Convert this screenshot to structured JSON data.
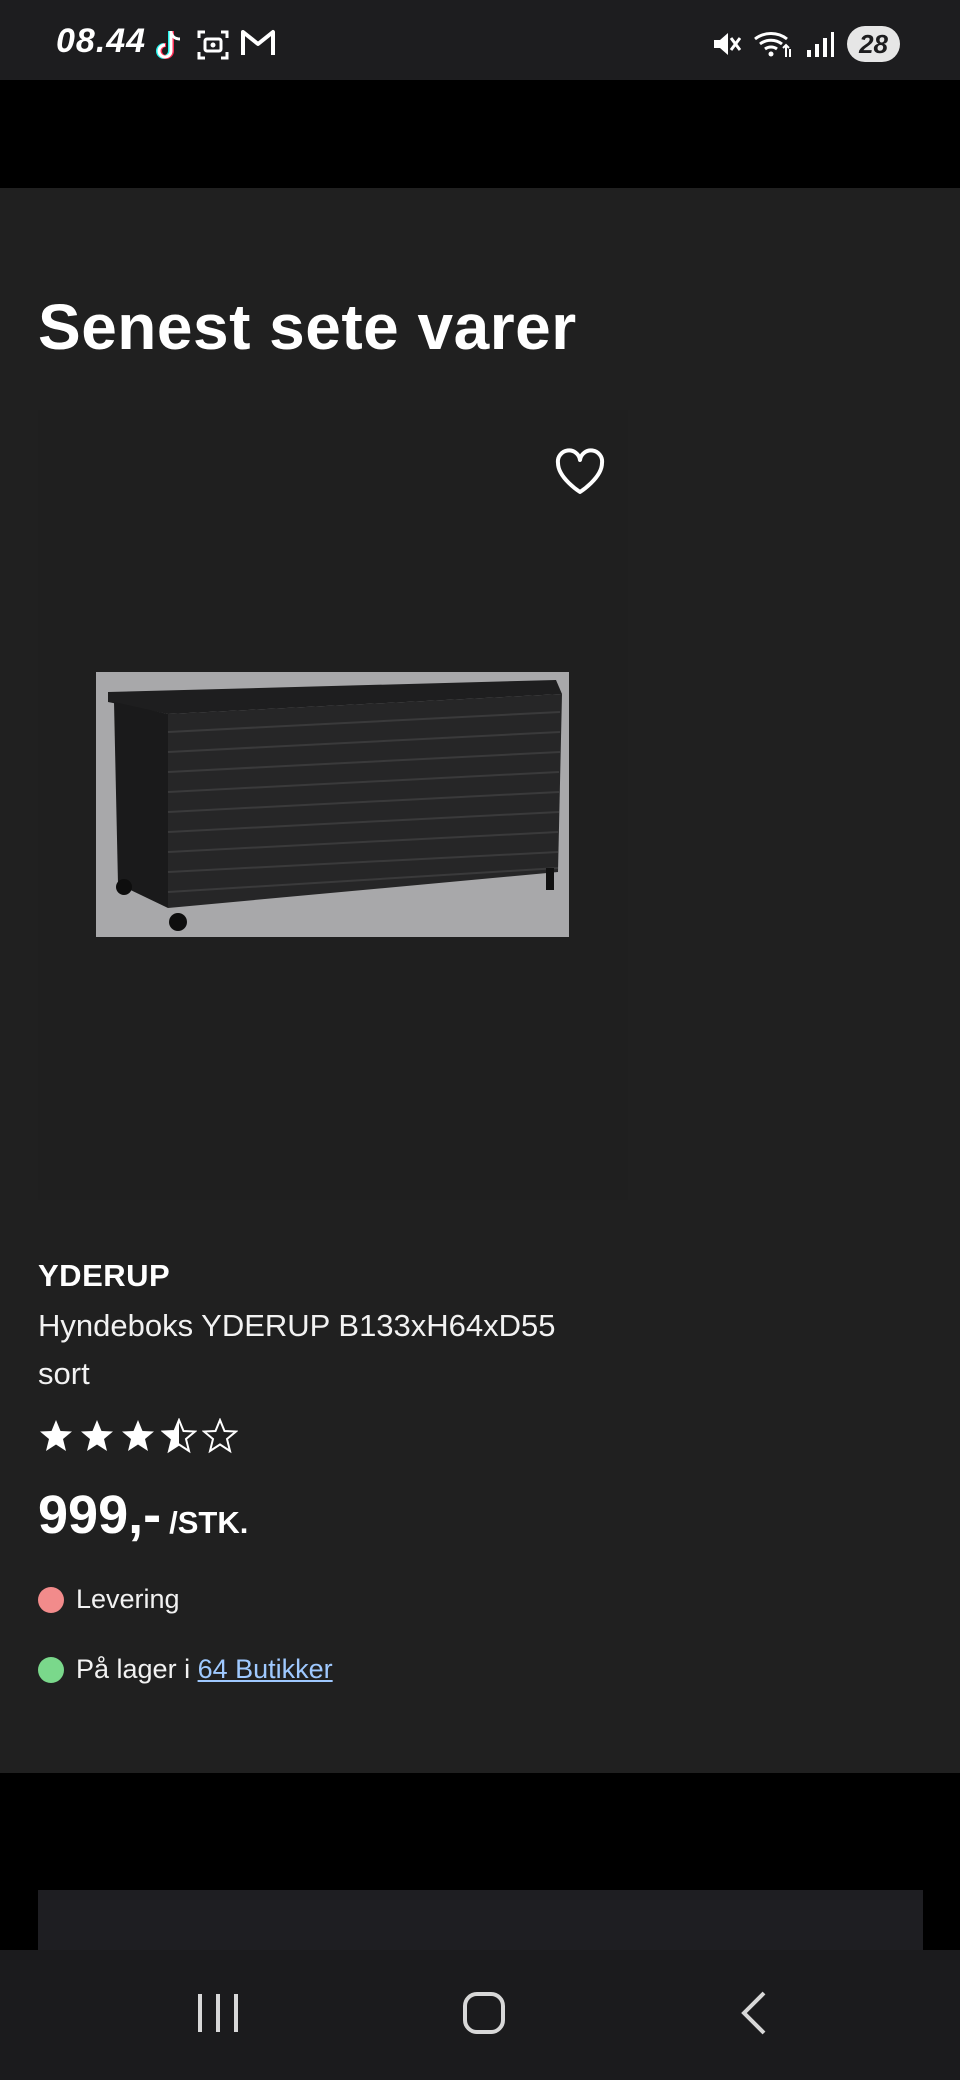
{
  "status_bar": {
    "time": "08.44",
    "battery": "28",
    "left_icons": [
      "tiktok-icon",
      "screenshot-icon",
      "gmail-icon"
    ],
    "right_icons": [
      "mute-icon",
      "wifi-icon",
      "signal-icon"
    ]
  },
  "section": {
    "title": "Senest sete varer"
  },
  "product": {
    "brand": "YDERUP",
    "name": "Hyndeboks YDERUP B133xH64xD55 sort",
    "rating": 3.5,
    "rating_max": 5,
    "price": "999,-",
    "unit": "/STK.",
    "delivery_label": "Levering",
    "delivery_color": "#f28b8b",
    "stock_prefix": "På lager i ",
    "stock_link": "64 Butikker",
    "stock_color": "#7ad88b"
  },
  "nav": {
    "icons": [
      "recent-apps-icon",
      "home-icon",
      "back-icon"
    ]
  }
}
